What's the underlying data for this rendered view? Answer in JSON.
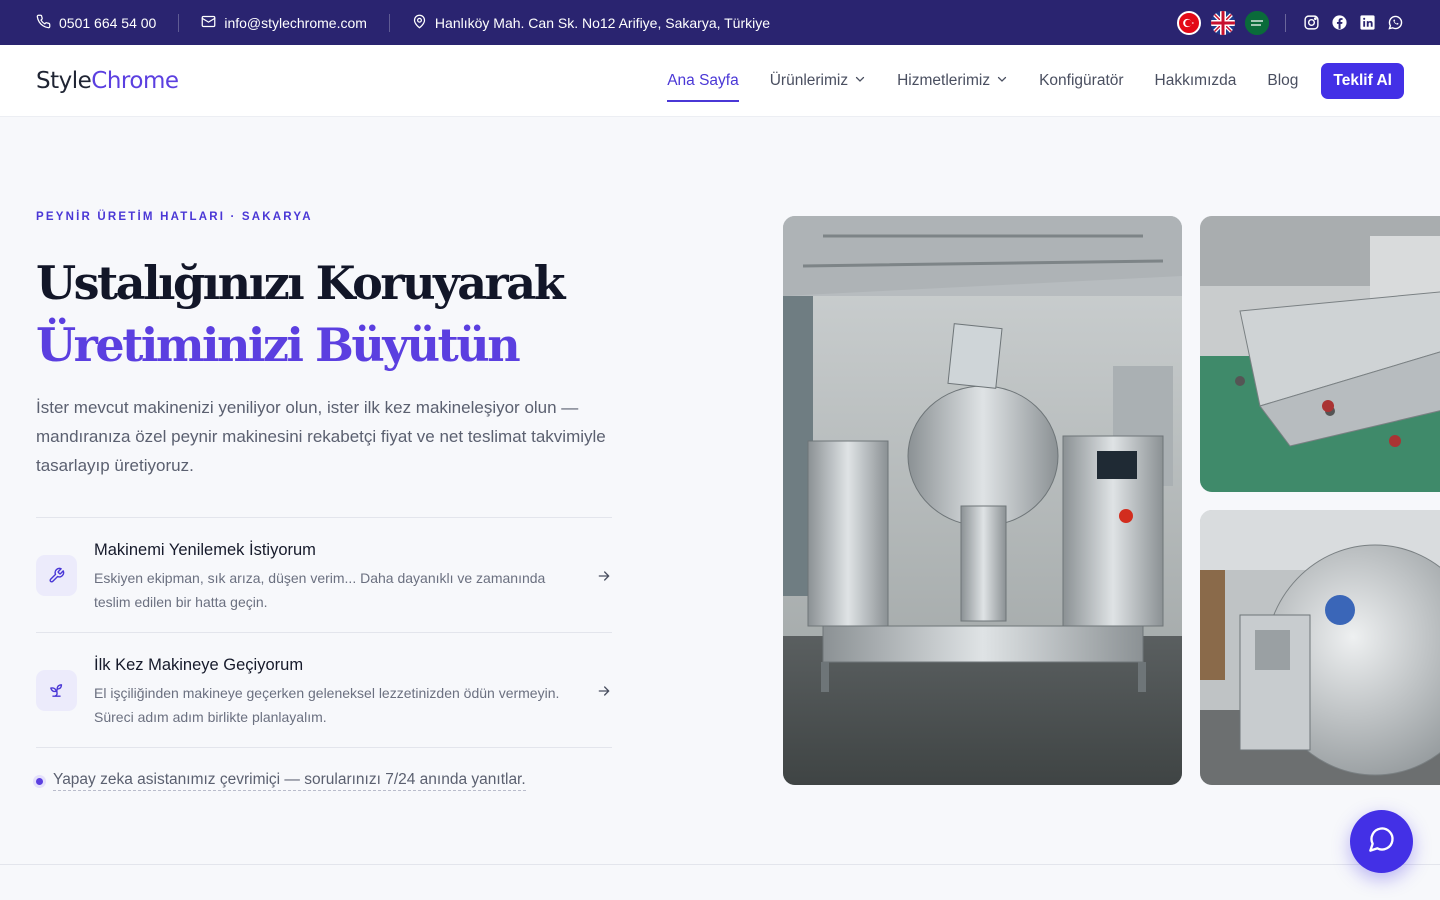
{
  "topbar": {
    "phone": "0501 664 54 00",
    "email": "info@stylechrome.com",
    "address": "Hanlıköy Mah. Can Sk. No12 Arifiye, Sakarya, Türkiye",
    "languages": [
      {
        "code": "tr",
        "icon": "turkey-flag-icon"
      },
      {
        "code": "en",
        "icon": "uk-flag-icon"
      },
      {
        "code": "ar",
        "icon": "saudi-flag-icon"
      }
    ],
    "socials": [
      "instagram-icon",
      "facebook-icon",
      "linkedin-icon",
      "whatsapp-icon"
    ]
  },
  "header": {
    "logo_part1": "Style",
    "logo_part2": "Chrome",
    "nav": [
      {
        "label": "Ana Sayfa",
        "active": true
      },
      {
        "label": "Ürünlerimiz",
        "dropdown": true
      },
      {
        "label": "Hizmetlerimiz",
        "dropdown": true
      },
      {
        "label": "Konfigüratör"
      },
      {
        "label": "Hakkımızda"
      },
      {
        "label": "Blog"
      }
    ],
    "cta_label": "Teklif Al"
  },
  "hero": {
    "eyebrow": "PEYNİR ÜRETİM HATLARI · SAKARYA",
    "title_line1": "Ustalığınızı Koruyarak",
    "title_line2": "Üretiminizi Büyütün",
    "lead": "İster mevcut makinenizi yeniliyor olun, ister ilk kez makineleşiyor olun — mandıranıza özel peynir makinesini rekabetçi fiyat ve net teslimat takvimiyle tasarlayıp üretiyoruz.",
    "options": [
      {
        "icon": "wrench-icon",
        "title": "Makinemi Yenilemek İstiyorum",
        "desc": "Eskiyen ekipman, sık arıza, düşen verim... Daha dayanıklı ve zamanında teslim edilen bir hatta geçin."
      },
      {
        "icon": "sprout-icon",
        "title": "İlk Kez Makineye Geçiyorum",
        "desc": "El işçiliğinden makineye geçerken geleneksel lezzetinizden ödün vermeyin. Süreci adım adım birlikte planlayalım."
      }
    ],
    "ai_note": "Yapay zeka asistanımız çevrimiçi — sorularınızı 7/24 anında yanıtlar."
  },
  "colors": {
    "topbar_bg": "#2a2470",
    "accent": "#4330e6",
    "accent_text": "#5b3fe0",
    "page_bg": "#f7f8fb"
  }
}
